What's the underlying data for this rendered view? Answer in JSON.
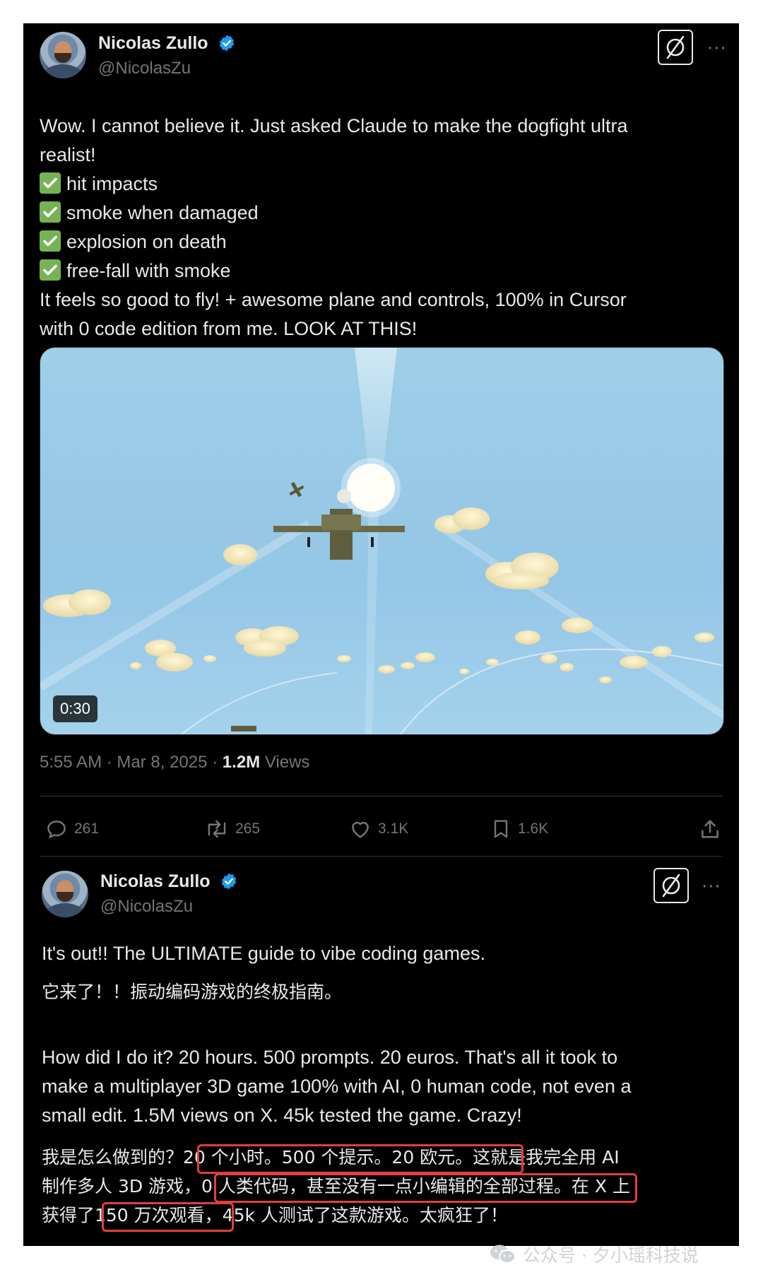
{
  "tweet1": {
    "author_name": "Nicolas Zullo",
    "handle": "@NicolasZu",
    "text_lines": [
      "Wow. I cannot believe it. Just asked Claude to make the dogfight ultra",
      "realist!"
    ],
    "checklist": [
      "hit impacts",
      "smoke when damaged",
      "explosion on death",
      "free-fall with smoke"
    ],
    "closing_lines": [
      "It feels so good to fly! + awesome plane and controls, 100% in Cursor",
      "with 0 code edition from me. LOOK AT THIS!"
    ],
    "video_duration": "0:30",
    "timestamp": "5:55 AM · Mar 8, 2025 · ",
    "views_count": "1.2M",
    "views_label": " Views",
    "actions": {
      "replies": "261",
      "reposts": "265",
      "likes": "3.1K",
      "bookmarks": "1.6K"
    }
  },
  "tweet2": {
    "author_name": "Nicolas Zullo",
    "handle": "@NicolasZu",
    "line1": "It's out!! The ULTIMATE guide to vibe coding games.",
    "line1_zh": "它来了！！振动编码游戏的终极指南。",
    "para_lines": [
      "How did I do it? 20 hours. 500 prompts. 20 euros. That's all it took to",
      "make a multiplayer 3D game 100% with AI, 0 human code, not even a",
      "small edit. 1.5M views on X. 45k tested the game. Crazy!"
    ],
    "zh_lines": [
      "我是怎么做到的？20 个小时。500 个提示。20 欧元。这就是我完全用 AI",
      "制作多人 3D 游戏，0 人类代码，甚至没有一点小编辑的全部过程。在 X 上",
      "获得了150 万次观看，45k 人测试了这款游戏。太疯狂了！"
    ]
  },
  "watermark": "公众号 · 夕小瑶科技说",
  "colors": {
    "background": "#000000",
    "text": "#e7e9ea",
    "muted": "#71767b",
    "verified": "#1d9bf0",
    "check": "#77b255",
    "highlight": "#e0403e"
  }
}
